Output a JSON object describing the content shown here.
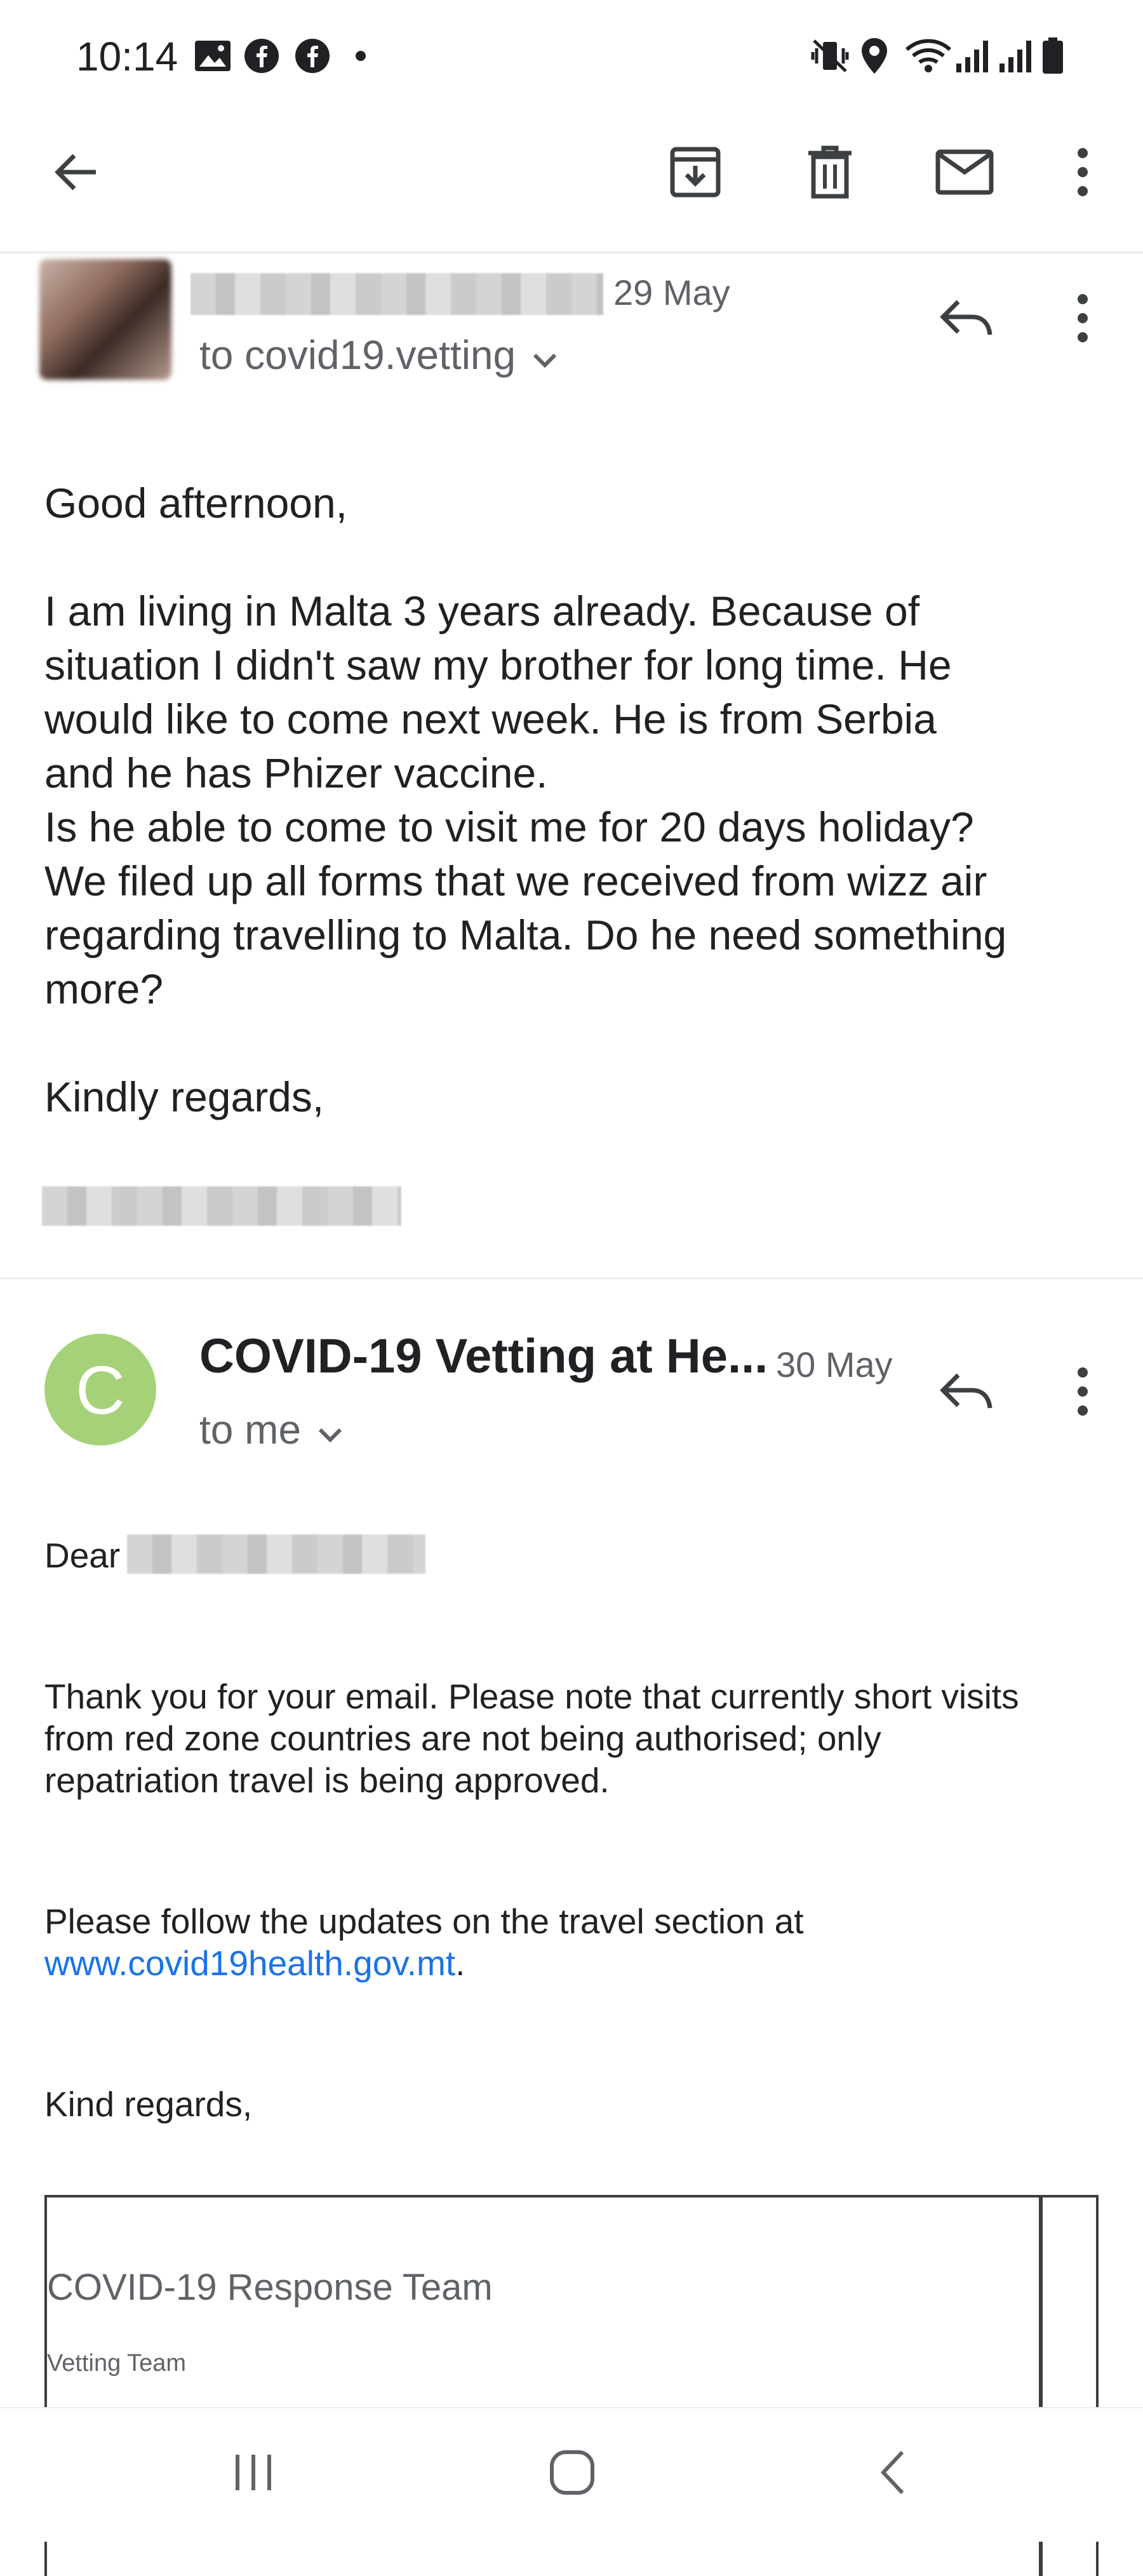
{
  "status_bar": {
    "time": "10:14",
    "left_icons": [
      "image-icon",
      "facebook-icon",
      "facebook-icon",
      "dot-icon"
    ],
    "right_icons": [
      "vibrate-icon",
      "location-icon",
      "wifi-icon",
      "signal-icon",
      "signal-icon",
      "battery-icon"
    ]
  },
  "toolbar": {
    "icons": [
      "back-arrow-icon",
      "archive-icon",
      "delete-icon",
      "mark-unread-icon",
      "more-vert-icon"
    ]
  },
  "message1": {
    "date": "29 May",
    "to_line": "to covid19.vetting",
    "greeting": "Good afternoon,",
    "lines": [
      "I am living in Malta 3 years already. Because of",
      "situation I didn't saw my brother for long time. He",
      "would like to come next week. He is from Serbia",
      "and he has Phizer vaccine.",
      "Is he able to come to visit me for 20 days holiday?",
      "We filed up all forms that we received from wizz air",
      "regarding travelling to Malta. Do he need something",
      "more?"
    ],
    "closing": "Kindly regards,"
  },
  "message2": {
    "avatar_letter": "C",
    "sender": "COVID-19 Vetting at He...",
    "date": "30 May",
    "to_line": "to me",
    "salutation": "Dear",
    "para1_lines": [
      "Thank you for your email. Please note that currently short visits",
      "from red zone countries are not being authorised; only",
      "repatriation travel is being approved."
    ],
    "para2_text": "Please follow the updates on the travel section at",
    "link": "www.covid19health.gov.mt",
    "link_suffix": ".",
    "closing": "Kind regards,",
    "signature_title": "COVID-19 Response Team",
    "signature_subtitle": "Vetting Team"
  },
  "colors": {
    "avatar_green": "#a5d279",
    "link_blue": "#1a73e8",
    "secondary_text": "#5f6368"
  }
}
